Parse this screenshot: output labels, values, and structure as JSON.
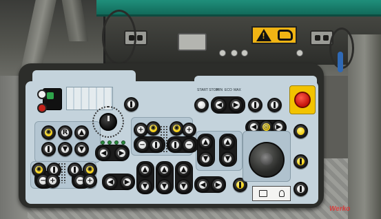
{
  "scene": {
    "subject": "machine-control-panel",
    "panel_color": "#c4d3dc",
    "frame_color": "#2c2d2a",
    "machine_body_color": "#1f8f7b",
    "warning_label_color": "#f0b414",
    "estop_color": "#c4120a"
  },
  "labels": {
    "start_stop": "START STOP",
    "min": "MIN",
    "eco": "ECO",
    "max": "MAX"
  },
  "watermark": {
    "text": "Werko"
  }
}
